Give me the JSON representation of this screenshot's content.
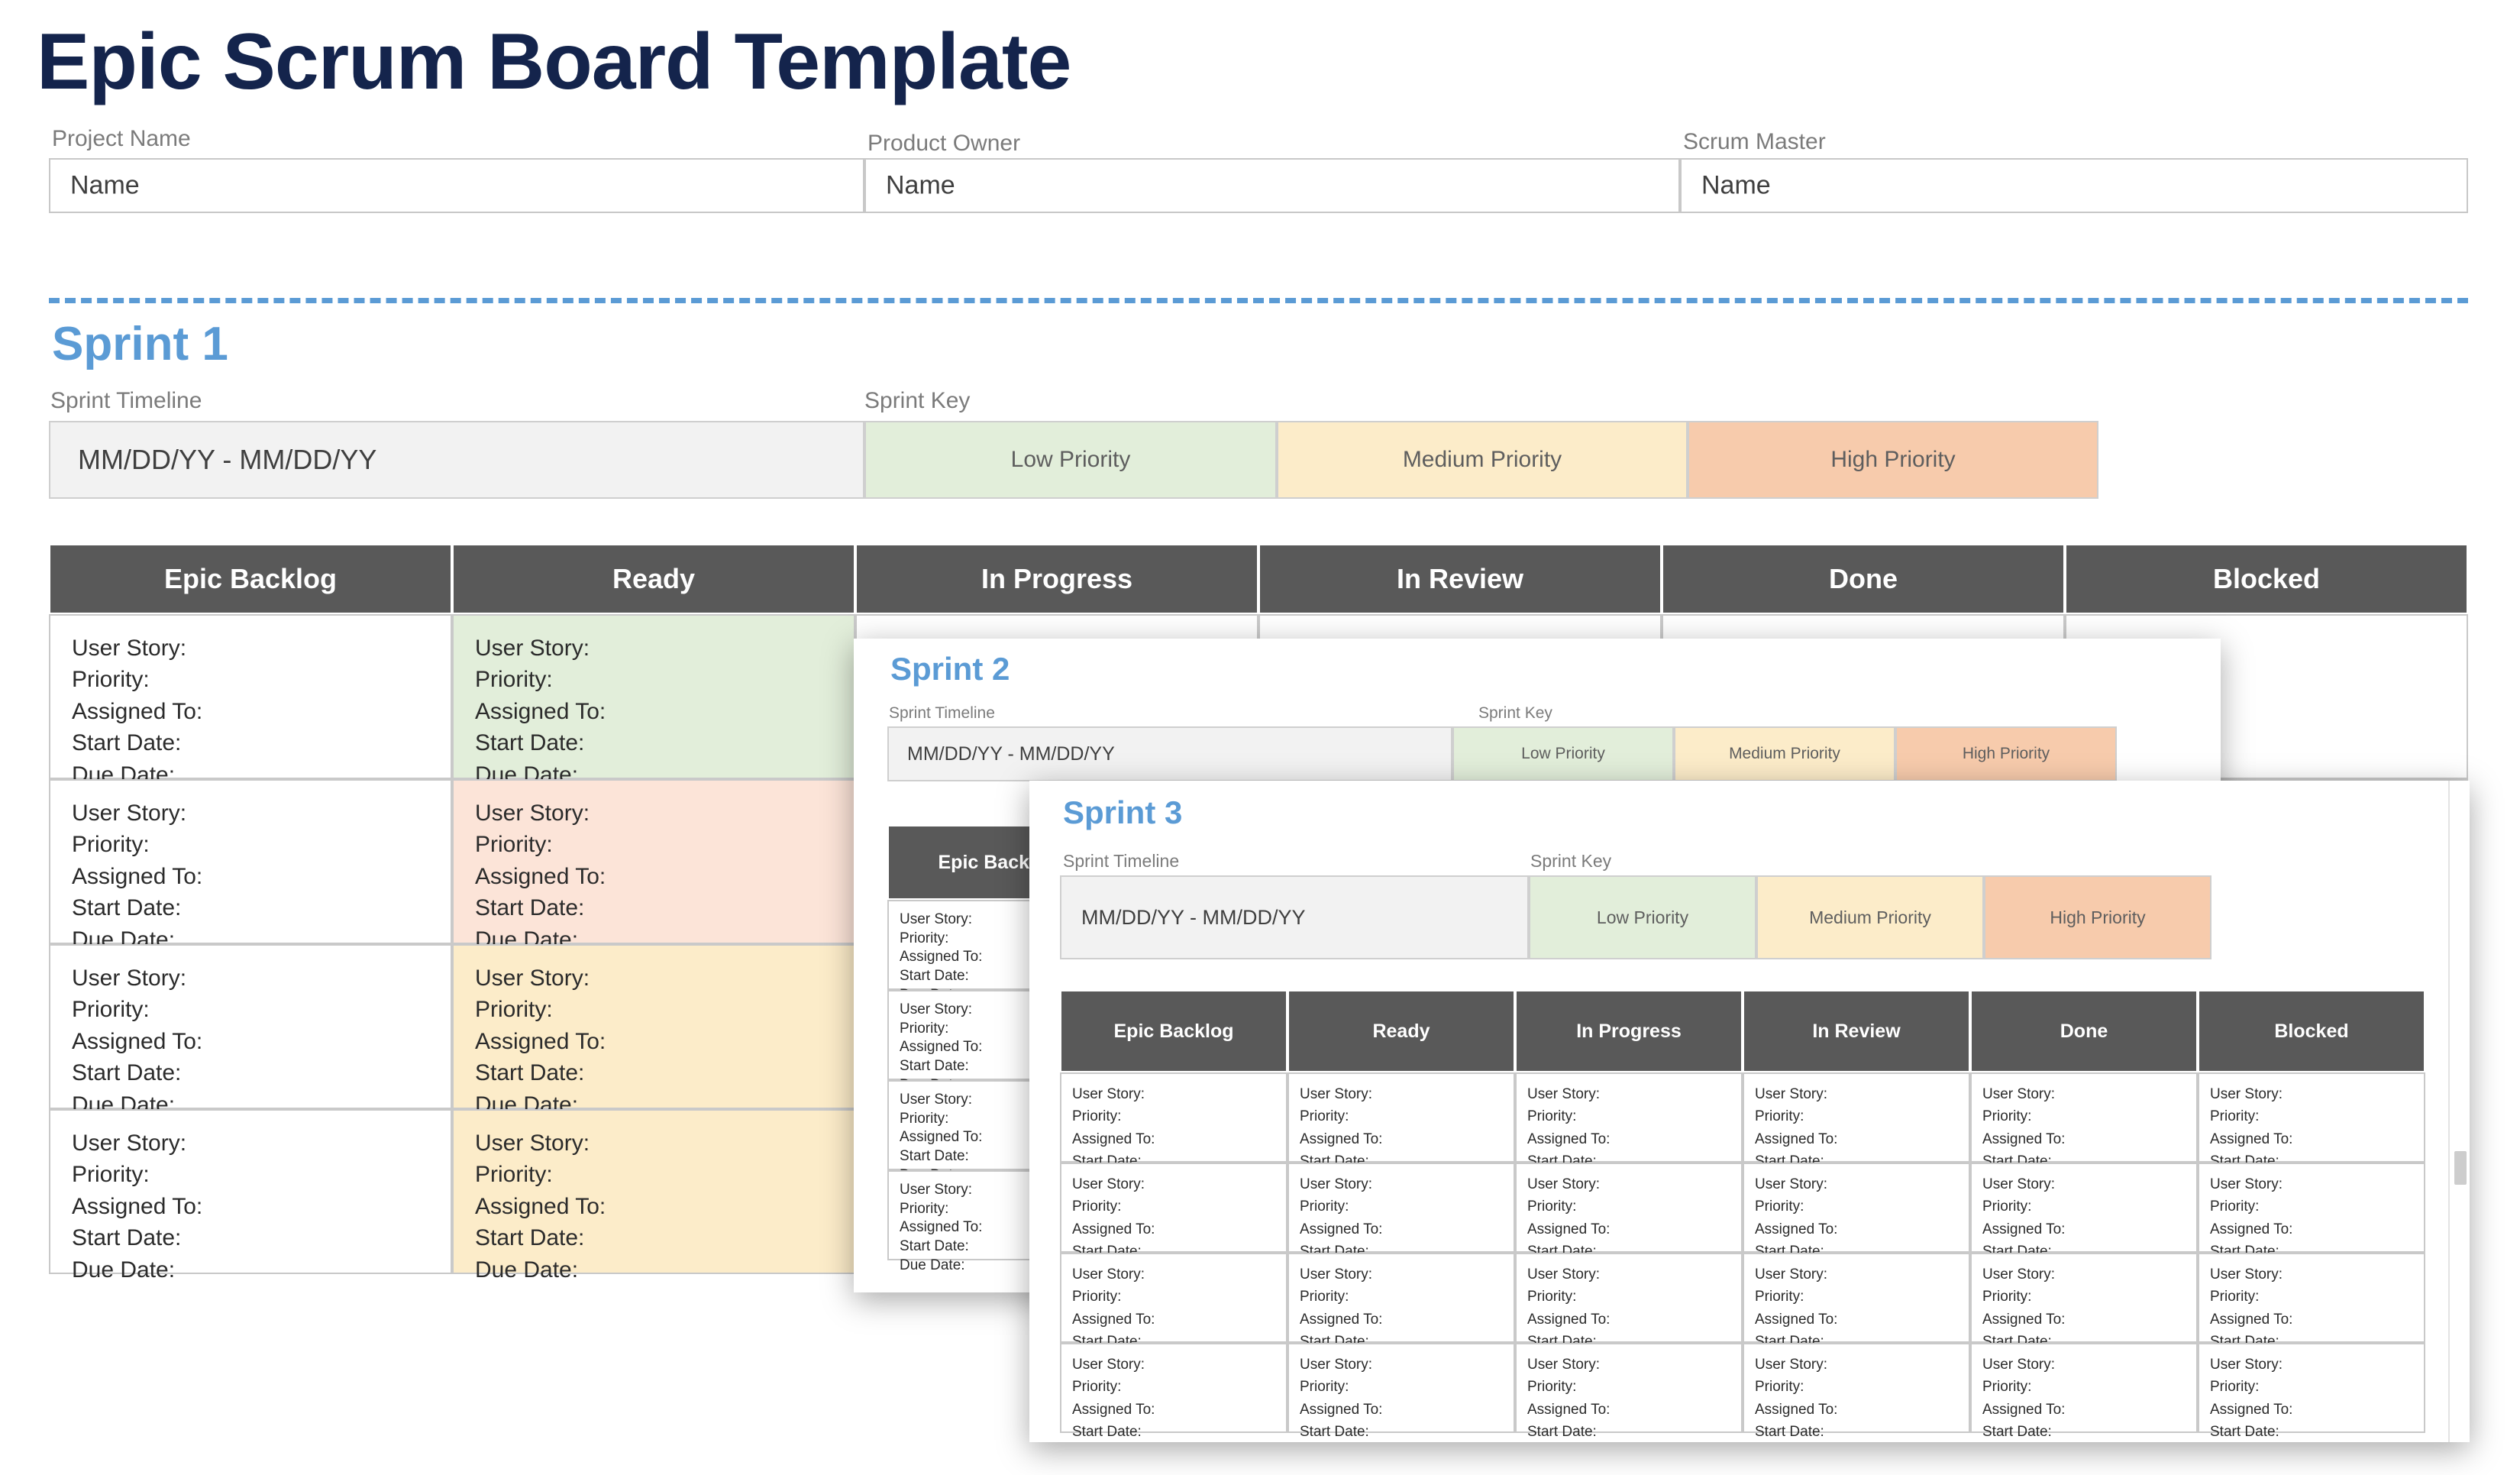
{
  "document": {
    "title": "Epic Scrum Board Template"
  },
  "meta_fields": [
    {
      "label": "Project Name",
      "value": "Name"
    },
    {
      "label": "Product Owner",
      "value": "Name"
    },
    {
      "label": "Scrum Master",
      "value": "Name"
    }
  ],
  "labels": {
    "sprint_timeline": "Sprint Timeline",
    "sprint_key": "Sprint Key",
    "timeline_value": "MM/DD/YY - MM/DD/YY"
  },
  "sprint_key": [
    {
      "label": "Low Priority",
      "color": "#e2eeda"
    },
    {
      "label": "Medium Priority",
      "color": "#fcecc9"
    },
    {
      "label": "High Priority",
      "color": "#f7cbac"
    }
  ],
  "board_columns": [
    "Epic Backlog",
    "Ready",
    "In Progress",
    "In Review",
    "Done",
    "Blocked"
  ],
  "card_fields": [
    "User Story:",
    "Priority:",
    "Assigned To:",
    "Start Date:",
    "Due Date:"
  ],
  "sprints": [
    {
      "name": "Sprint 1",
      "timeline": "MM/DD/YY - MM/DD/YY",
      "row_colors": [
        [
          "#ffffff",
          "#e2eeda",
          "#ffffff",
          "#ffffff",
          "#ffffff",
          "#ffffff"
        ],
        [
          "#ffffff",
          "#fce4d8",
          "#ffffff",
          "#ffffff",
          "#ffffff",
          "#ffffff"
        ],
        [
          "#ffffff",
          "#fcecc9",
          "#ffffff",
          "#ffffff",
          "#ffffff",
          "#ffffff"
        ],
        [
          "#ffffff",
          "#fcecc9",
          "#ffffff",
          "#ffffff",
          "#ffffff",
          "#ffffff"
        ]
      ]
    },
    {
      "name": "Sprint 2",
      "timeline": "MM/DD/YY - MM/DD/YY",
      "row_colors": [
        [
          "#ffffff",
          "#ffffff",
          "#ffffff",
          "#ffffff",
          "#ffffff",
          "#ffffff"
        ],
        [
          "#ffffff",
          "#ffffff",
          "#ffffff",
          "#ffffff",
          "#ffffff",
          "#ffffff"
        ],
        [
          "#ffffff",
          "#ffffff",
          "#ffffff",
          "#ffffff",
          "#ffffff",
          "#ffffff"
        ],
        [
          "#ffffff",
          "#ffffff",
          "#ffffff",
          "#ffffff",
          "#ffffff",
          "#ffffff"
        ]
      ]
    },
    {
      "name": "Sprint 3",
      "timeline": "MM/DD/YY - MM/DD/YY",
      "row_colors": [
        [
          "#ffffff",
          "#ffffff",
          "#ffffff",
          "#ffffff",
          "#ffffff",
          "#ffffff"
        ],
        [
          "#ffffff",
          "#ffffff",
          "#ffffff",
          "#ffffff",
          "#ffffff",
          "#ffffff"
        ],
        [
          "#ffffff",
          "#ffffff",
          "#ffffff",
          "#ffffff",
          "#ffffff",
          "#ffffff"
        ],
        [
          "#ffffff",
          "#ffffff",
          "#ffffff",
          "#ffffff",
          "#ffffff",
          "#ffffff"
        ]
      ]
    }
  ],
  "theme": {
    "title_color": "#14244c",
    "sprint_color": "#5b9bd5",
    "header_bar": "#595959",
    "label_gray": "#7b7b7b",
    "divider": "#5b9bd5"
  }
}
